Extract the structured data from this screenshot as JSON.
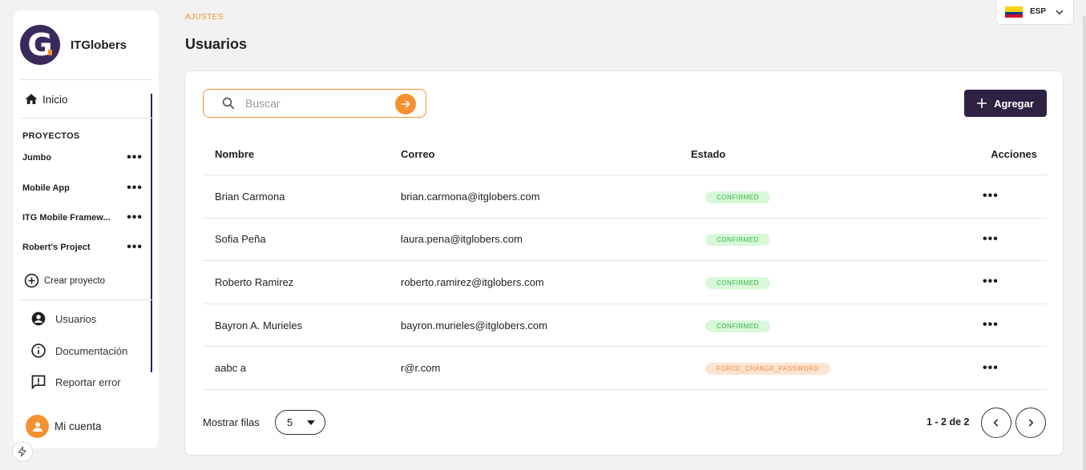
{
  "brand": {
    "name": "ITGlobers",
    "logo_letter": "G"
  },
  "sidebar": {
    "home_label": "Inicio",
    "projects_heading": "PROYECTOS",
    "projects": [
      {
        "name": "Jumbo",
        "more": "•••"
      },
      {
        "name": "Mobile App",
        "more": "•••"
      },
      {
        "name": "ITG Mobile Framew...",
        "more": "•••"
      },
      {
        "name": "Robert's Project",
        "more": "•••"
      }
    ],
    "create_project_label": "Crear proyecto",
    "users_label": "Usuarios",
    "docs_label": "Documentación",
    "report_label": "Reportar error",
    "account_label": "Mi cuenta"
  },
  "header": {
    "breadcrumb": "AJUSTES",
    "title": "Usuarios",
    "language": "ESP"
  },
  "toolbar": {
    "search_placeholder": "Buscar",
    "add_label": "Agregar"
  },
  "table": {
    "columns": [
      "Nombre",
      "Correo",
      "Estado",
      "Acciones"
    ],
    "rows": [
      {
        "name": "Brian Carmona",
        "email": "brian.carmona@itglobers.com",
        "status": "CONFIRMED",
        "actions": "•••"
      },
      {
        "name": "Sofia Peña",
        "email": "laura.pena@itglobers.com",
        "status": "CONFIRMED",
        "actions": "•••"
      },
      {
        "name": "Roberto Ramirez",
        "email": "roberto.ramirez@itglobers.com",
        "status": "CONFIRMED",
        "actions": "•••"
      },
      {
        "name": "Bayron A. Murieles",
        "email": "bayron.murieles@itglobers.com",
        "status": "CONFIRMED",
        "actions": "•••"
      },
      {
        "name": "aabc a",
        "email": "r@r.com",
        "status": "FORCE_CHANGE_PASSWORD",
        "actions": "•••"
      }
    ]
  },
  "pagination": {
    "rows_label": "Mostrar filas",
    "rows_value": "5",
    "info": "1 - 2 de 2"
  },
  "colors": {
    "accent": "#f5922f",
    "primary": "#2e2144",
    "confirmed_bg": "#d8f8d8",
    "confirmed_text": "#36b24a",
    "warn_bg": "#fde4d2",
    "warn_text": "#f08a3a"
  }
}
